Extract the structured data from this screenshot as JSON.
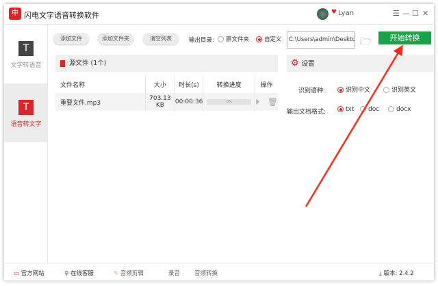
{
  "app": {
    "title": "闪电文字语音转换软件",
    "user": "Lyan",
    "logo_text": "中"
  },
  "window_controls": [
    "menu-icon",
    "minimize-icon",
    "maximize-icon",
    "close-icon"
  ],
  "sidebar": {
    "items": [
      {
        "label": "文字转语音",
        "active": false
      },
      {
        "label": "语音转文字",
        "active": true
      }
    ]
  },
  "toolbar": {
    "add_file": "添加文件",
    "add_folder": "添加文件夹",
    "clear_list": "清空列表",
    "output_dir_label": "输出目录:",
    "opt_source": "原文件夹",
    "opt_custom": "自定义",
    "output_dir_selected": "自定义",
    "path": "C:\\Users\\admin\\Desktop\\",
    "start": "开始转换"
  },
  "files": {
    "header": "源文件 (1个)",
    "columns": [
      "文件名称",
      "大小",
      "时长(s)",
      "转换进度",
      "操作"
    ],
    "rows": [
      {
        "name": "重要文件.mp3",
        "size": "703.13 KB",
        "duration": "00:00:36",
        "progress": "0%"
      }
    ]
  },
  "settings": {
    "header": "设置",
    "lang_label": "识别语种:",
    "lang_options": [
      "识别中文",
      "识别英文"
    ],
    "lang_selected": "识别中文",
    "format_label": "输出文档格式:",
    "format_options": [
      "txt",
      "doc",
      "docx"
    ],
    "format_selected": "txt"
  },
  "footer": {
    "site": "官方网站",
    "service": "在线客服",
    "audio_cut": "音频剪辑",
    "record": "录音",
    "audio_convert": "音频转换",
    "version": "版本: 2.4.2"
  },
  "colors": {
    "accent": "#d8262a",
    "start_button": "#17a34a",
    "arrow": "#ff2a1a"
  }
}
